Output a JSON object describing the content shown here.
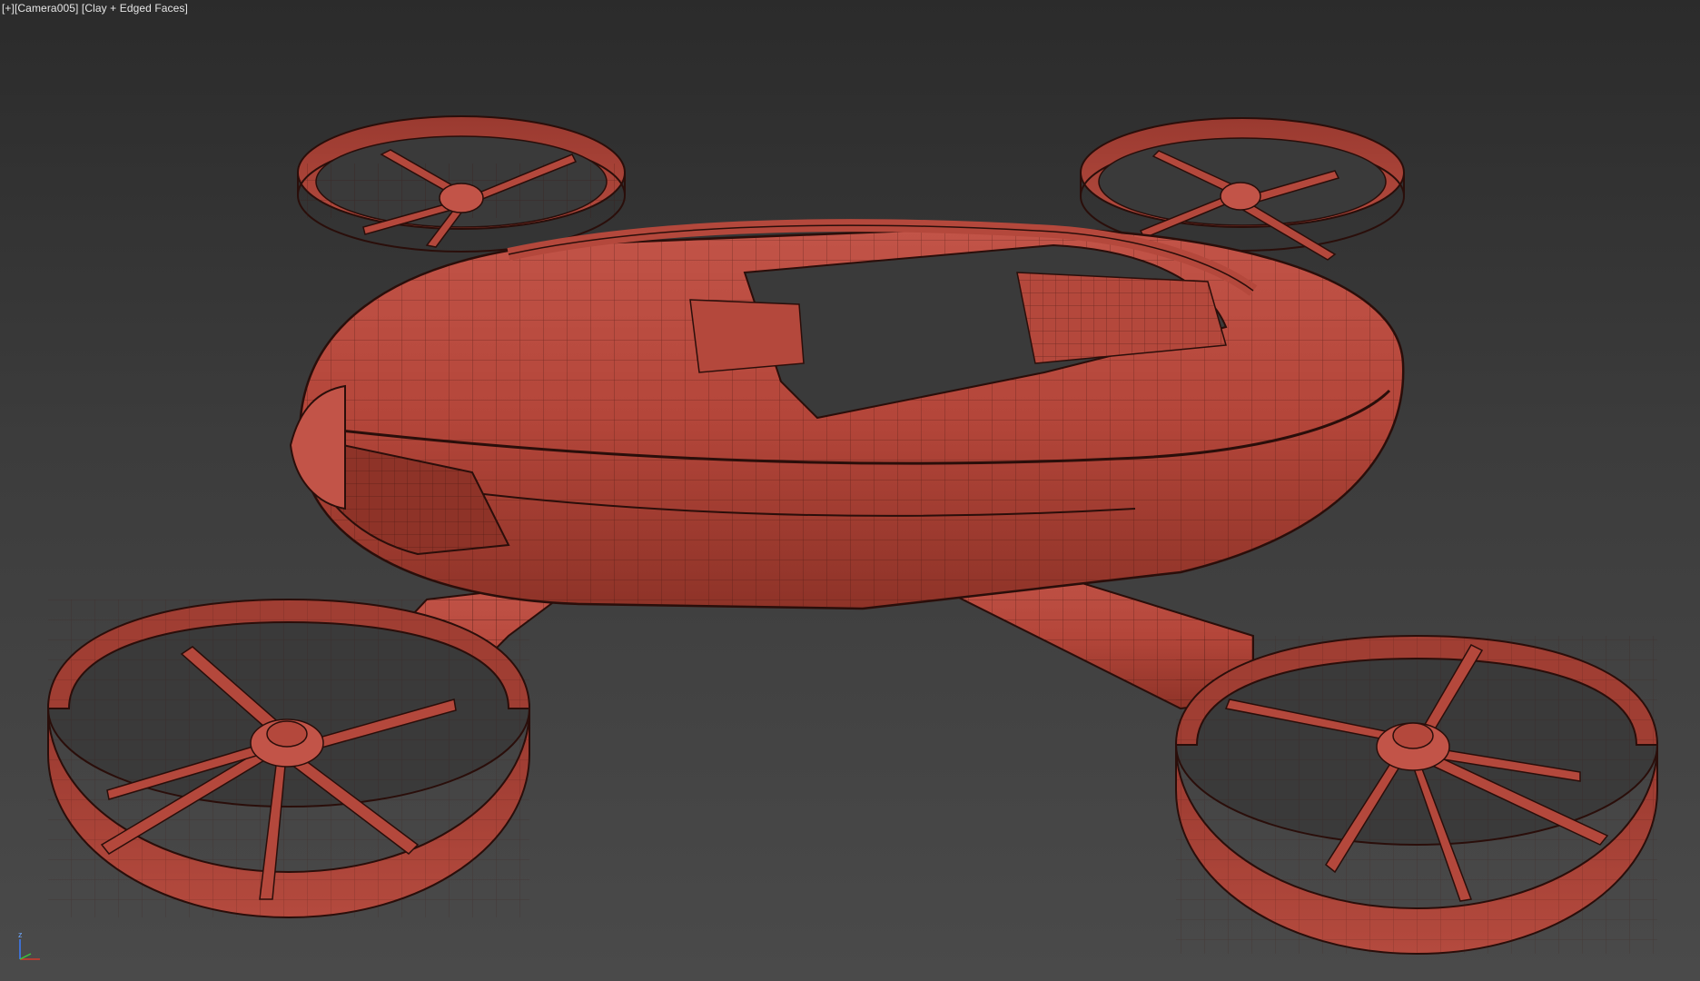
{
  "viewport": {
    "label_plus": "[+]",
    "label_camera": "[Camera005]",
    "label_shading": "[Clay + Edged Faces]"
  },
  "axis_gizmo": {
    "z_label": "z",
    "x_color": "#d43a2a",
    "y_color": "#3ac43a",
    "z_color": "#3a7cff"
  },
  "colors": {
    "clay": "#b4483c",
    "clay_light": "#c85a4c",
    "clay_dark": "#7a2a22",
    "edge": "#2a0e0a",
    "background_top": "#2b2b2b",
    "background_bottom": "#4a4a4a"
  }
}
